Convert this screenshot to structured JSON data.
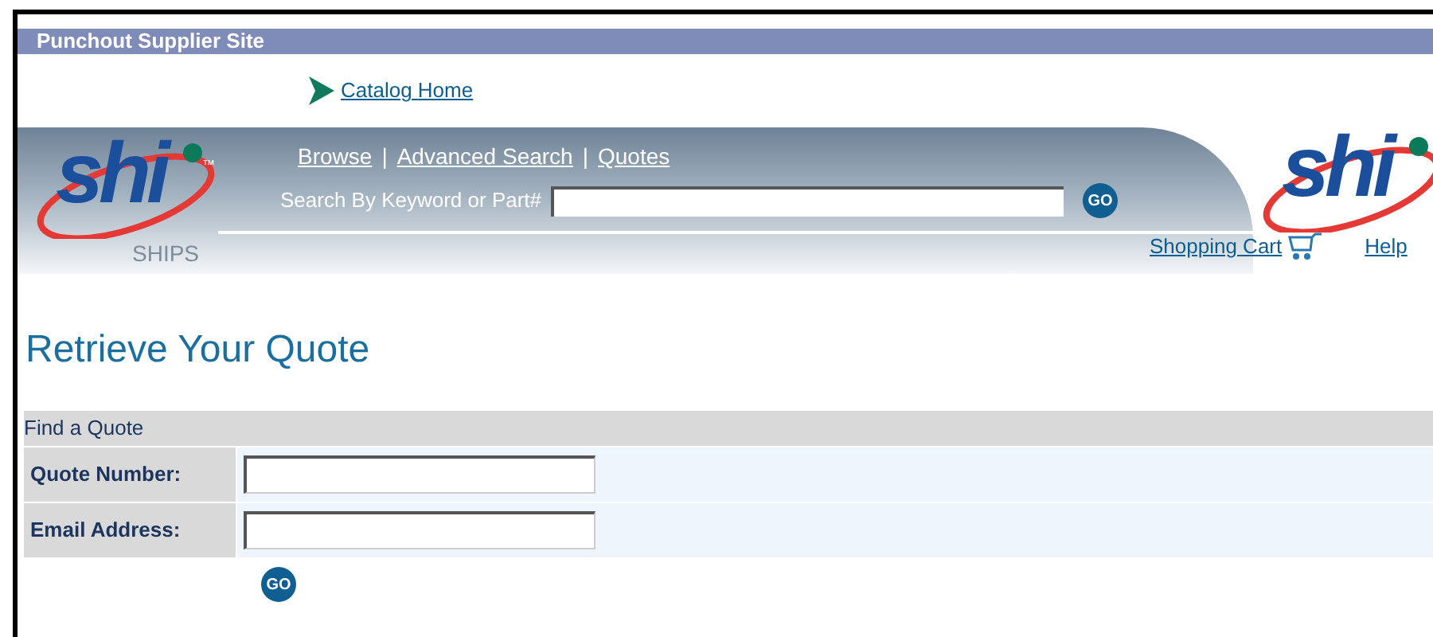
{
  "site_bar": {
    "title": "Punchout Supplier Site"
  },
  "catalog_link": "Catalog Home",
  "header": {
    "logo_text": "shi",
    "logo_mark": "™",
    "nav": [
      {
        "label": "Browse",
        "separator": "|"
      },
      {
        "label": "Advanced Search",
        "separator": "|"
      },
      {
        "label": "Quotes"
      }
    ],
    "search": {
      "label": "Search By Keyword or Part#",
      "button": "GO"
    },
    "ships": "SHIPS",
    "right_logo_text": "shi",
    "cart_link": "Shopping Cart",
    "help_link": "Help"
  },
  "page_title": "Retrieve Your Quote",
  "form": {
    "title": "Find a Quote",
    "fields": [
      {
        "label": "Quote Number:"
      },
      {
        "label": "Email Address:"
      }
    ],
    "button": "GO"
  }
}
